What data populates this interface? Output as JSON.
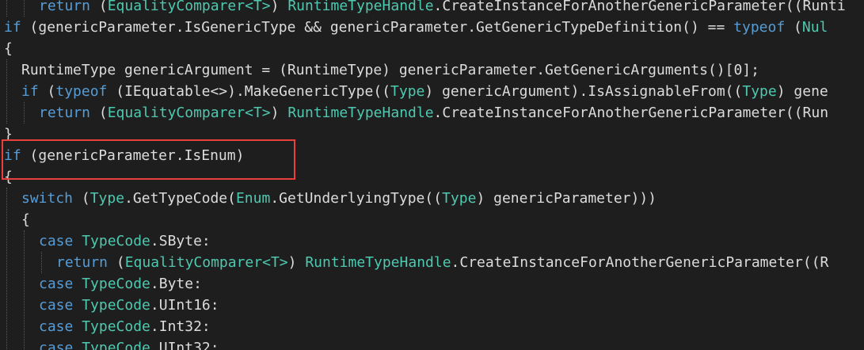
{
  "editor": {
    "lines": [
      {
        "indent": 2,
        "tokens": [
          {
            "t": "return",
            "c": "kw"
          },
          {
            "t": " ("
          },
          {
            "t": "EqualityComparer<T>",
            "c": "ty"
          },
          {
            "t": ") "
          },
          {
            "t": "RuntimeTypeHandle",
            "c": "ty"
          },
          {
            "t": ".CreateInstanceForAnotherGenericParameter((Runti"
          }
        ]
      },
      {
        "indent": 0,
        "tokens": [
          {
            "t": "if",
            "c": "kw"
          },
          {
            "t": " (genericParameter.IsGenericType && genericParameter.GetGenericTypeDefinition() == "
          },
          {
            "t": "typeof",
            "c": "kw"
          },
          {
            "t": " ("
          },
          {
            "t": "Nul",
            "c": "ty"
          }
        ]
      },
      {
        "indent": 0,
        "tokens": [
          {
            "t": "{"
          }
        ]
      },
      {
        "indent": 1,
        "tokens": [
          {
            "t": "RuntimeType genericArgument = (RuntimeType) genericParameter.GetGenericArguments()[0];"
          }
        ]
      },
      {
        "indent": 1,
        "tokens": [
          {
            "t": "if",
            "c": "kw"
          },
          {
            "t": " ("
          },
          {
            "t": "typeof",
            "c": "kw"
          },
          {
            "t": " (IEquatable<>).MakeGenericType(("
          },
          {
            "t": "Type",
            "c": "ty"
          },
          {
            "t": ") genericArgument).IsAssignableFrom(("
          },
          {
            "t": "Type",
            "c": "ty"
          },
          {
            "t": ") gene"
          }
        ]
      },
      {
        "indent": 2,
        "tokens": [
          {
            "t": "return",
            "c": "kw"
          },
          {
            "t": " ("
          },
          {
            "t": "EqualityComparer<T>",
            "c": "ty"
          },
          {
            "t": ") "
          },
          {
            "t": "RuntimeTypeHandle",
            "c": "ty"
          },
          {
            "t": ".CreateInstanceForAnotherGenericParameter((Run"
          }
        ]
      },
      {
        "indent": 0,
        "tokens": [
          {
            "t": "}"
          }
        ]
      },
      {
        "indent": 0,
        "tokens": [
          {
            "t": "if",
            "c": "kw"
          },
          {
            "t": " (genericParameter.IsEnum)"
          }
        ]
      },
      {
        "indent": 0,
        "tokens": [
          {
            "t": "{"
          }
        ]
      },
      {
        "indent": 1,
        "tokens": [
          {
            "t": "switch",
            "c": "kw"
          },
          {
            "t": " ("
          },
          {
            "t": "Type",
            "c": "ty"
          },
          {
            "t": ".GetTypeCode("
          },
          {
            "t": "Enum",
            "c": "ty"
          },
          {
            "t": ".GetUnderlyingType(("
          },
          {
            "t": "Type",
            "c": "ty"
          },
          {
            "t": ") genericParameter)))"
          }
        ]
      },
      {
        "indent": 1,
        "tokens": [
          {
            "t": "{"
          }
        ]
      },
      {
        "indent": 2,
        "tokens": [
          {
            "t": "case",
            "c": "kw"
          },
          {
            "t": " "
          },
          {
            "t": "TypeCode",
            "c": "ty"
          },
          {
            "t": ".SByte:"
          }
        ]
      },
      {
        "indent": 3,
        "tokens": [
          {
            "t": "return",
            "c": "kw"
          },
          {
            "t": " ("
          },
          {
            "t": "EqualityComparer<T>",
            "c": "ty"
          },
          {
            "t": ") "
          },
          {
            "t": "RuntimeTypeHandle",
            "c": "ty"
          },
          {
            "t": ".CreateInstanceForAnotherGenericParameter((R"
          }
        ]
      },
      {
        "indent": 2,
        "tokens": [
          {
            "t": "case",
            "c": "kw"
          },
          {
            "t": " "
          },
          {
            "t": "TypeCode",
            "c": "ty"
          },
          {
            "t": ".Byte:"
          }
        ]
      },
      {
        "indent": 2,
        "tokens": [
          {
            "t": "case",
            "c": "kw"
          },
          {
            "t": " "
          },
          {
            "t": "TypeCode",
            "c": "ty"
          },
          {
            "t": ".UInt16:"
          }
        ]
      },
      {
        "indent": 2,
        "tokens": [
          {
            "t": "case",
            "c": "kw"
          },
          {
            "t": " "
          },
          {
            "t": "TypeCode",
            "c": "ty"
          },
          {
            "t": ".Int32:"
          }
        ]
      },
      {
        "indent": 2,
        "tokens": [
          {
            "t": "case",
            "c": "kw"
          },
          {
            "t": " "
          },
          {
            "t": "TypeCode",
            "c": "ty"
          },
          {
            "t": ".UInt32:"
          }
        ]
      }
    ],
    "highlight_line_index": 7,
    "colors": {
      "background": "#1e1e1e",
      "keyword": "#569cd6",
      "type": "#4ec9b0",
      "text": "#dcdcdc",
      "highlight_border": "#e8403c",
      "indent_guide": "#5a5a5a"
    }
  }
}
